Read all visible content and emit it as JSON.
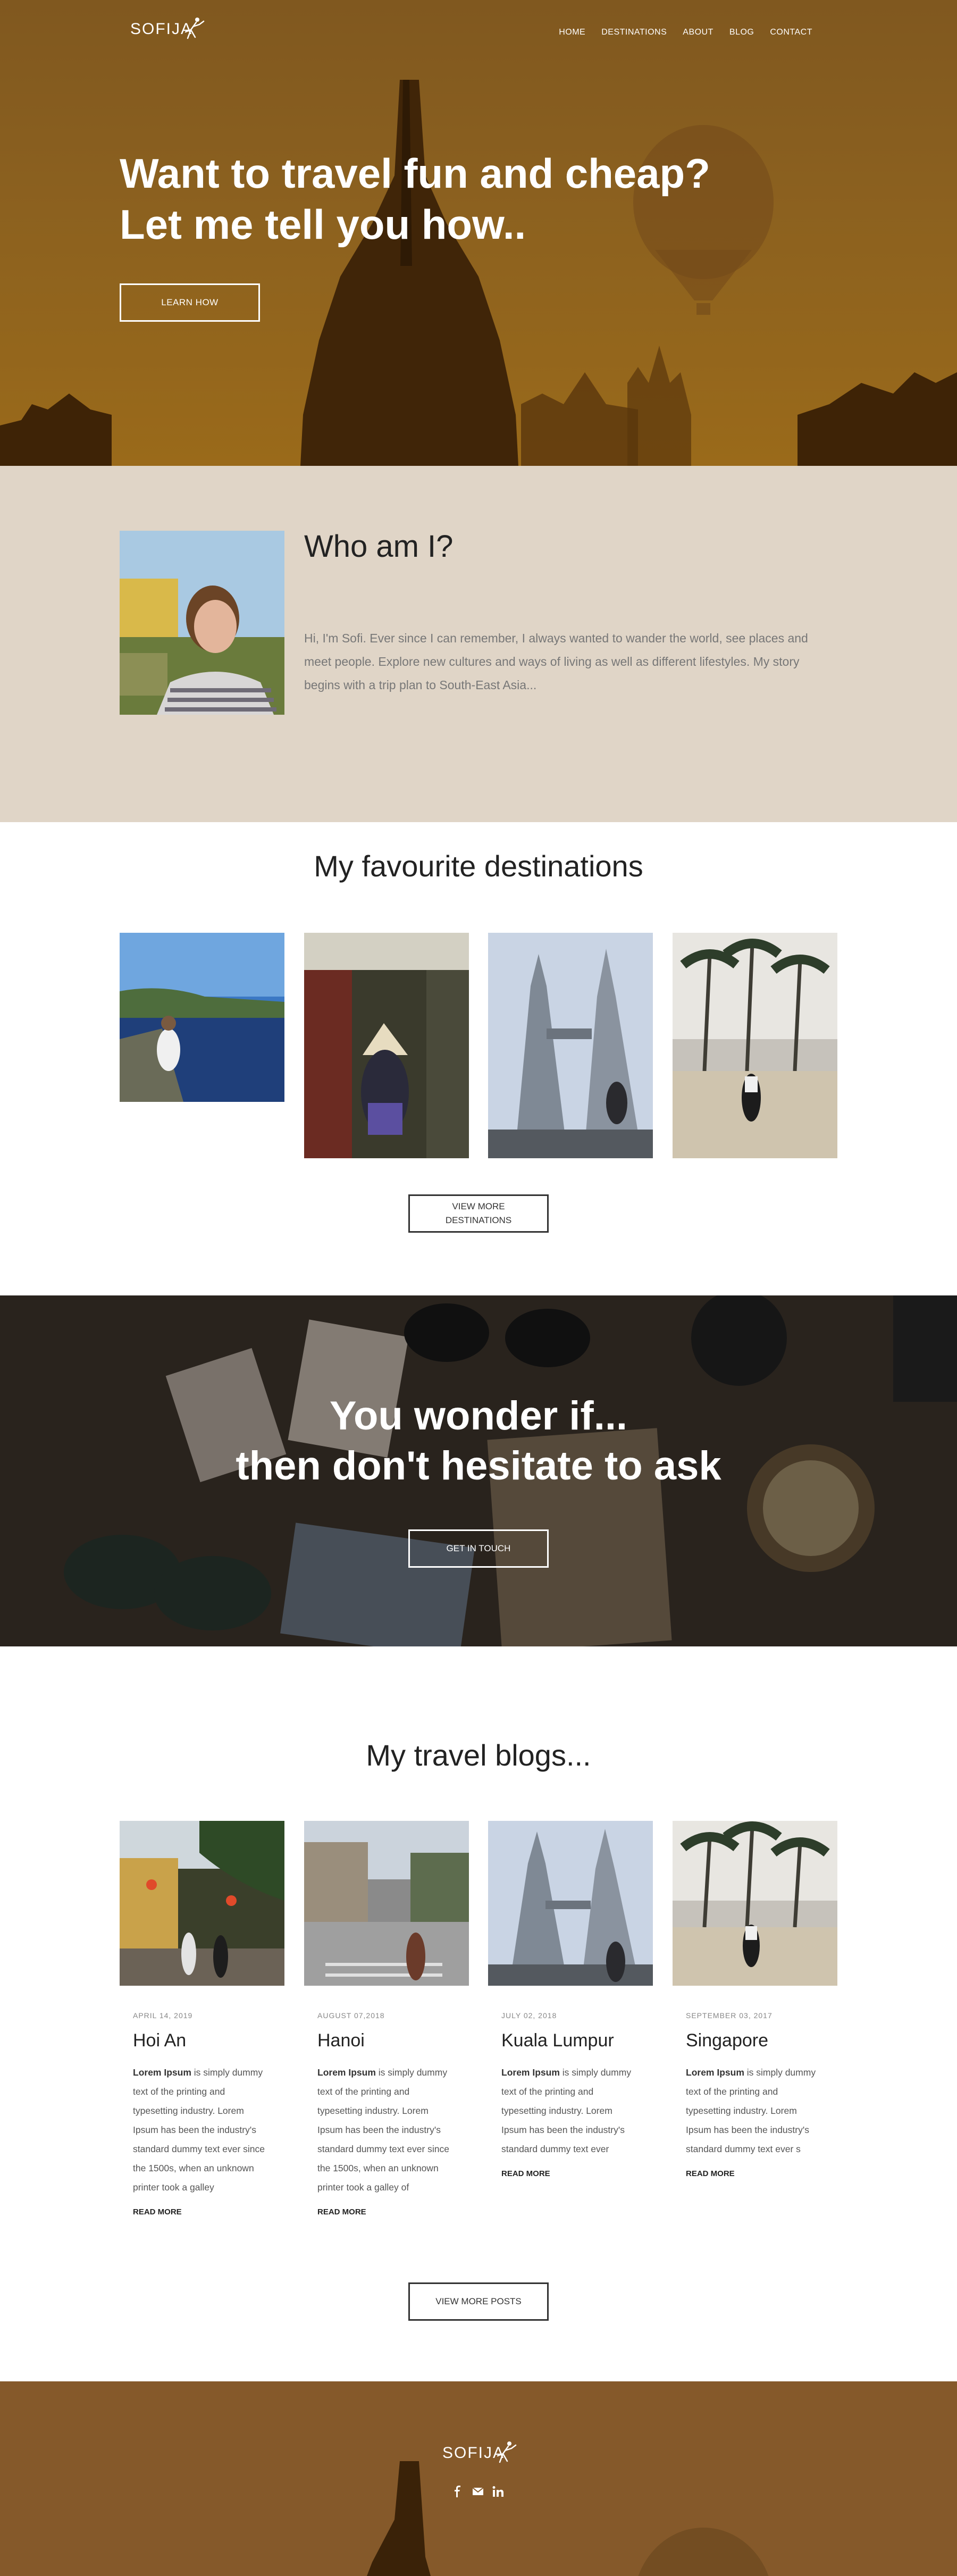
{
  "brand": {
    "logo": "SOFIJA"
  },
  "nav": {
    "items": [
      "HOME",
      "DESTINATIONS",
      "ABOUT",
      "BLOG",
      "CONTACT"
    ]
  },
  "hero": {
    "title_line1": "Want to travel fun and cheap?",
    "title_line2": "Let me tell you how..",
    "button": "LEARN HOW"
  },
  "about": {
    "title": "Who am I?",
    "text": "Hi, I'm Sofi. Ever since I can remember, I always wanted to wander the world, see places and meet people. Explore new cultures and ways of living as well as different lifestyles. My story begins with a trip plan to South-East Asia..."
  },
  "destinations": {
    "title": "My favourite destinations",
    "button_line1": "VIEW MORE",
    "button_line2": "DESTINATIONS"
  },
  "cta": {
    "title_line1": "You wonder if...",
    "title_line2": "then don't hesitate to ask",
    "button": "GET IN TOUCH"
  },
  "blogs": {
    "title": "My travel blogs...",
    "posts": [
      {
        "date": "APRIL 14, 2019",
        "title": "Hoi An",
        "bold": "Lorem Ipsum",
        "text": " is simply dummy text of the printing and typesetting industry. Lorem Ipsum has been the industry's standard dummy text ever since the 1500s, when an unknown printer took a galley",
        "more": "READ MORE"
      },
      {
        "date": "AUGUST 07,2018",
        "title": "Hanoi",
        "bold": "Lorem Ipsum",
        "text": " is simply dummy text of the printing and typesetting industry. Lorem Ipsum has been the industry's standard dummy text ever since the 1500s, when an unknown printer took a galley of",
        "more": "READ MORE"
      },
      {
        "date": "JULY 02, 2018",
        "title": "Kuala Lumpur",
        "bold": "Lorem Ipsum",
        "text": " is simply dummy text of the printing and typesetting industry. Lorem Ipsum has been the industry's standard dummy text ever",
        "more": "READ MORE"
      },
      {
        "date": "SEPTEMBER 03, 2017",
        "title": "Singapore",
        "bold": "Lorem Ipsum",
        "text": " is simply dummy text of the printing and typesetting industry. Lorem Ipsum has been the industry's standard dummy text ever s",
        "more": "READ MORE"
      }
    ],
    "button": "VIEW MORE POSTS"
  },
  "footer": {
    "logo": "SOFIJA",
    "social": [
      "facebook-icon",
      "mail-icon",
      "linkedin-icon"
    ]
  },
  "colors": {
    "hero": "#8c611f",
    "about_bg": "#e0d5c7",
    "footer": "#85592a",
    "text_muted": "#777777"
  }
}
